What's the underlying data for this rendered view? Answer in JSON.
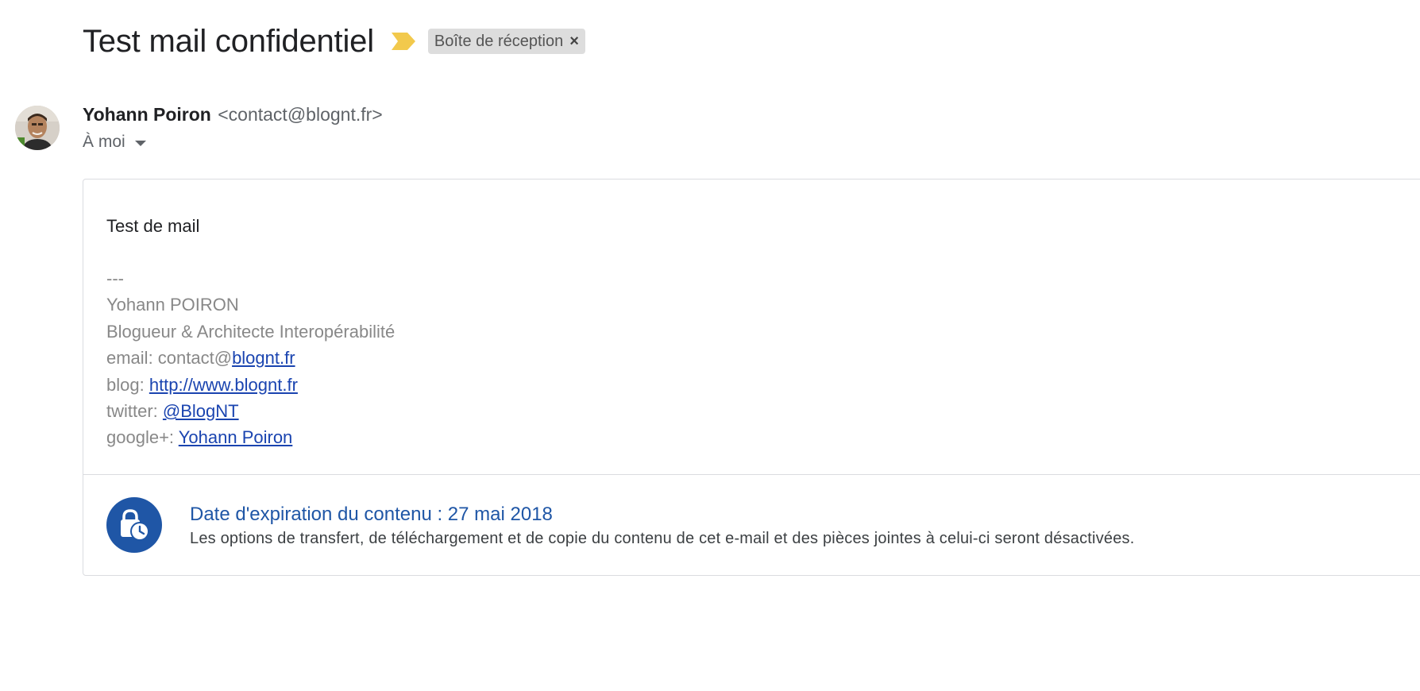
{
  "message": {
    "subject": "Test mail confidentiel",
    "importance_icon": "importance-marker-icon",
    "label": {
      "text": "Boîte de réception",
      "close": "×"
    }
  },
  "sender": {
    "name": "Yohann Poiron",
    "email": "<contact@blognt.fr>",
    "avatar_icon": "avatar-photo",
    "recipient_label": "À moi"
  },
  "body": {
    "text": "Test de mail",
    "signature": {
      "separator": "---",
      "name": "Yohann POIRON",
      "role": "Blogueur & Architecte Interopérabilité",
      "email_prefix": "email: contact@",
      "email_link": "blognt.fr",
      "blog_prefix": "blog: ",
      "blog_link": "http://www.blognt.fr",
      "twitter_prefix": "twitter: ",
      "twitter_link": "@BlogNT",
      "google_prefix": "google+: ",
      "google_link": "Yohann Poiron"
    }
  },
  "confidential": {
    "icon": "lock-clock-icon",
    "title": "Date d'expiration du contenu : 27 mai 2018",
    "description": "Les options de transfert, de téléchargement et de copie du contenu de cet e-mail et des pièces jointes à celui-ci seront désactivées."
  },
  "colors": {
    "link": "#1a44b0",
    "accent": "#1f56a6",
    "importance": "#f2c94c",
    "chip_bg": "#dddddd"
  }
}
